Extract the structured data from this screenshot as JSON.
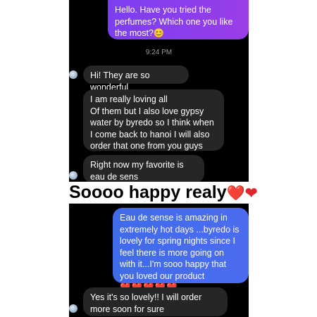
{
  "chat_top": {
    "sent_1": {
      "text": "Hello. Have you tried the perfumes? Which one you like the most?",
      "emoji": "😊"
    },
    "timestamp": "9:24 PM",
    "received_1": "Hi! They are so wonderful",
    "received_2": "I am really loving all\nOf them but I also love gypsy water by byredo so I think when I come back to hanoi I will also order that one from you guys",
    "received_3": "Right now my favorite is eau de sens"
  },
  "caption": {
    "text": "Soooo happy realy",
    "hearts": "❤️❤"
  },
  "chat_bottom": {
    "sent_2": {
      "text": "Eau de sense is amazing in extremely hot days ...byredo is lovely for spring nights since I feel there is more going on with it...I'm sooo happy that you loved our product",
      "hearts": "❤️❤️❤️❤️❤️"
    },
    "received_4": "Yes it's so lovely!! I will order more soon for sure"
  },
  "colors": {
    "sent_purple": "#8b3ef0",
    "sent_blue": "#4a6cf0",
    "received": "#262626",
    "heart": "#e0262d"
  },
  "icons": [
    "contact-avatar-icon"
  ]
}
